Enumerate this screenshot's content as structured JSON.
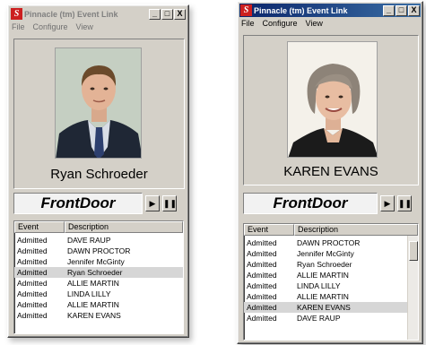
{
  "menu": {
    "file": "File",
    "configure": "Configure",
    "view": "View"
  },
  "titlebar": {
    "minimize": "_",
    "restore": "□",
    "close": "X"
  },
  "windows": [
    {
      "title": "Pinnacle (tm) Event Link",
      "icon": "pinnacle-s-icon",
      "person_name": "Ryan Schroeder",
      "door": "FrontDoor",
      "controls": {
        "play": "▶",
        "pause": "❚❚"
      },
      "columns": [
        "Event",
        "Description"
      ],
      "rows": [
        {
          "event": "Admitted",
          "description": "DAVE RAUP"
        },
        {
          "event": "Admitted",
          "description": "DAWN PROCTOR"
        },
        {
          "event": "Admitted",
          "description": "Jennifer McGinty"
        },
        {
          "event": "Admitted",
          "description": "Ryan Schroeder",
          "selected": true
        },
        {
          "event": "Admitted",
          "description": "ALLIE MARTIN"
        },
        {
          "event": "Admitted",
          "description": "LINDA LILLY"
        },
        {
          "event": "Admitted",
          "description": "ALLIE MARTIN"
        },
        {
          "event": "Admitted",
          "description": "KAREN EVANS"
        }
      ]
    },
    {
      "title": "Pinnacle (tm) Event Link",
      "icon": "pinnacle-s-icon",
      "person_name": "KAREN EVANS",
      "door": "FrontDoor",
      "controls": {
        "play": "▶",
        "pause": "❚❚"
      },
      "columns": [
        "Event",
        "Description"
      ],
      "rows": [
        {
          "event": "Admitted",
          "description": "DAWN PROCTOR"
        },
        {
          "event": "Admitted",
          "description": "Jennifer McGinty"
        },
        {
          "event": "Admitted",
          "description": "Ryan Schroeder"
        },
        {
          "event": "Admitted",
          "description": "ALLIE MARTIN"
        },
        {
          "event": "Admitted",
          "description": "LINDA LILLY"
        },
        {
          "event": "Admitted",
          "description": "ALLIE MARTIN"
        },
        {
          "event": "Admitted",
          "description": "KAREN EVANS",
          "selected": true
        },
        {
          "event": "Admitted",
          "description": "DAVE RAUP"
        }
      ]
    }
  ],
  "colors": {
    "active_title": "#0a246a",
    "window_face": "#d4d0c8",
    "list_selection": "#d6d6d6",
    "logo_red": "#cc1f1f"
  }
}
